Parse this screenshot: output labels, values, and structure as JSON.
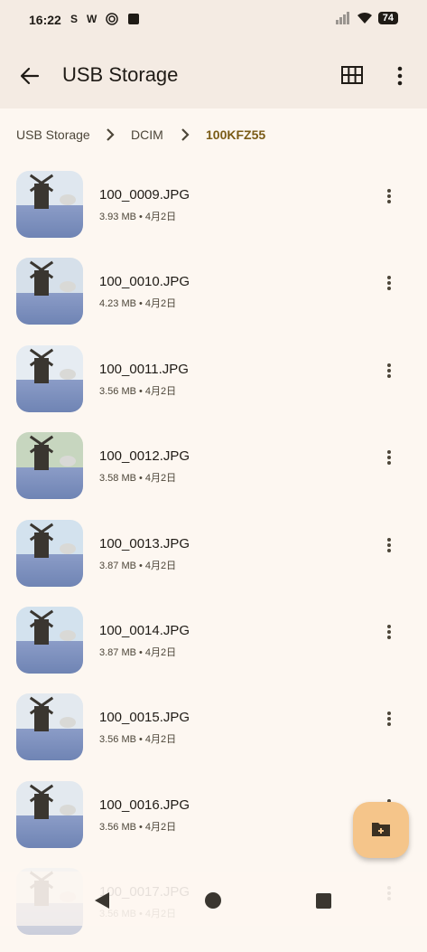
{
  "status_bar": {
    "time": "16:22",
    "left_icons": [
      "S",
      "W"
    ],
    "battery": "74"
  },
  "app_bar": {
    "title": "USB Storage",
    "back_icon": "arrow-back-icon",
    "grid_icon": "grid-view-icon",
    "more_icon": "more-vert-icon"
  },
  "breadcrumb": {
    "items": [
      "USB Storage",
      "DCIM",
      "100KFZ55"
    ]
  },
  "files": [
    {
      "name": "100_0009.JPG",
      "meta": "3.93 MB • 4月2日"
    },
    {
      "name": "100_0010.JPG",
      "meta": "4.23 MB • 4月2日"
    },
    {
      "name": "100_0011.JPG",
      "meta": "3.56 MB • 4月2日"
    },
    {
      "name": "100_0012.JPG",
      "meta": "3.58 MB • 4月2日"
    },
    {
      "name": "100_0013.JPG",
      "meta": "3.87 MB • 4月2日"
    },
    {
      "name": "100_0014.JPG",
      "meta": "3.87 MB • 4月2日"
    },
    {
      "name": "100_0015.JPG",
      "meta": "3.56 MB • 4月2日"
    },
    {
      "name": "100_0016.JPG",
      "meta": "3.56 MB • 4月2日"
    },
    {
      "name": "100_0017.JPG",
      "meta": "3.56 MB • 4月2日"
    }
  ],
  "fab": {
    "icon": "new-folder-icon"
  },
  "colors": {
    "background": "#fdf7f1",
    "app_bar": "#f4ebe3",
    "accent": "#7a5b16",
    "fab": "#f5c58a"
  }
}
